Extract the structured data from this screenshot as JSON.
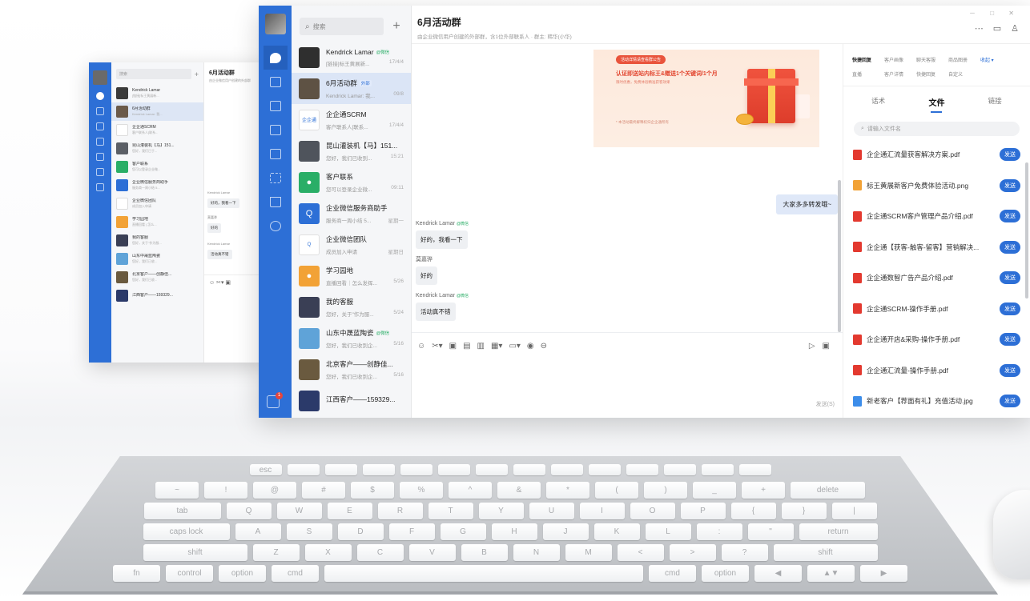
{
  "back_window": {
    "search_placeholder": "搜索",
    "chat_title": "6月活动群",
    "chat_subtitle": "由企业微信用户创建的外部群",
    "contacts": [
      {
        "name": "Kendrick Lamar",
        "preview": "[链接]标王黄展新...",
        "time": "17/4/4",
        "color": "#3a3a3a"
      },
      {
        "name": "6月活动群",
        "preview": "Kendrick Lamar: 我...",
        "time": "",
        "color": "#6b5a4a"
      },
      {
        "name": "企企通SCRM",
        "preview": "客户联系人[联系...",
        "time": "17/4/4",
        "color": "#ffffff"
      },
      {
        "name": "昆山灌装机【马】151...",
        "preview": "您好，我们已于...",
        "time": "15:21",
        "color": "#5b5f66"
      },
      {
        "name": "客户联系",
        "preview": "您可以登录企业微...",
        "time": "09:11",
        "color": "#2aae67"
      },
      {
        "name": "企业微信服务商助手",
        "preview": "服务商一周小结 5...",
        "time": "",
        "color": "#2d6fd6"
      },
      {
        "name": "企业微信团队",
        "preview": "成员加入申请",
        "time": "",
        "color": "#ffffff"
      },
      {
        "name": "学习园地",
        "preview": "直播回看 | 怎么...",
        "time": "5/26",
        "color": "#f2a236"
      },
      {
        "name": "我的客服",
        "preview": "您好，关于\"作为服...",
        "time": "5/24",
        "color": "#3a3f55"
      },
      {
        "name": "山东中晟蓝陶瓷",
        "preview": "您好，我们已收...",
        "time": "5/16",
        "color": "#5fa3d8"
      },
      {
        "name": "北京客户——创静佳...",
        "preview": "您好，我们已收...",
        "time": "5/16",
        "color": "#6a5a3f"
      },
      {
        "name": "江西客户——159329...",
        "preview": "",
        "time": "",
        "color": "#2b3a6a"
      }
    ],
    "msgs": [
      {
        "sender": "Kendrick Lamar",
        "text": "好的，我看一下"
      },
      {
        "sender": "莫嘉骅",
        "text": "好的"
      },
      {
        "sender": "Kendrick Lamar",
        "text": "活动真不错"
      }
    ]
  },
  "sidebar": {
    "icons": [
      "message-icon",
      "mail-icon",
      "workbench-icon",
      "calendar-icon",
      "document-icon",
      "apps-icon",
      "org-icon",
      "settings-icon"
    ],
    "notification_count": "1"
  },
  "conversations": {
    "search_placeholder": "搜索",
    "items": [
      {
        "name": "Kendrick Lamar",
        "tag": "@微信",
        "tag_style": "green",
        "preview": "[链接]标王黄展新...",
        "time": "17/4/4",
        "color": "#2f2f2f",
        "glyph": ""
      },
      {
        "name": "6月活动群",
        "tag": "外部",
        "tag_style": "blue",
        "preview": "Kendrick Lamar: 我...",
        "time": "09/8",
        "color": "#5e5244",
        "glyph": ""
      },
      {
        "name": "企企通SCRM",
        "tag": "",
        "tag_style": "",
        "preview": "客户联系人[联系...",
        "time": "17/4/4",
        "color": "#ffffff",
        "glyph": "企企通"
      },
      {
        "name": "昆山灌装机【马】151...",
        "tag": "",
        "tag_style": "",
        "preview": "您好，我们已收到...",
        "time": "15:21",
        "color": "#4f545c",
        "glyph": ""
      },
      {
        "name": "客户联系",
        "tag": "",
        "tag_style": "",
        "preview": "您可以登录企业微...",
        "time": "09:11",
        "color": "#2aae67",
        "glyph": "●"
      },
      {
        "name": "企业微信服务商助手",
        "tag": "",
        "tag_style": "",
        "preview": "服务商一周小结 5...",
        "time": "星期一",
        "color": "#2d6fd6",
        "glyph": "Q"
      },
      {
        "name": "企业微信团队",
        "tag": "",
        "tag_style": "",
        "preview": "成员加入申请",
        "time": "星期日",
        "color": "#ffffff",
        "glyph": "Q"
      },
      {
        "name": "学习园地",
        "tag": "",
        "tag_style": "",
        "preview": "直播回看｜怎么发挥...",
        "time": "5/26",
        "color": "#f2a236",
        "glyph": "●"
      },
      {
        "name": "我的客服",
        "tag": "",
        "tag_style": "",
        "preview": "您好，关于\"作为服...",
        "time": "5/24",
        "color": "#3a3f55",
        "glyph": ""
      },
      {
        "name": "山东中晟蓝陶瓷",
        "tag": "@微信",
        "tag_style": "green",
        "preview": "您好，我们已收到企...",
        "time": "5/16",
        "color": "#5fa3d8",
        "glyph": ""
      },
      {
        "name": "北京客户——创静佳...",
        "tag": "",
        "tag_style": "",
        "preview": "您好，我们已收到企...",
        "time": "5/16",
        "color": "#6a5a3f",
        "glyph": ""
      },
      {
        "name": "江西客户——159329...",
        "tag": "",
        "tag_style": "",
        "preview": "",
        "time": "",
        "color": "#2b3a6a",
        "glyph": ""
      }
    ]
  },
  "chat": {
    "title": "6月活动群",
    "subtitle": "由企业微信用户创建的外部群，含1位外部联系人 · 群主: 韩华(小华)",
    "window_controls": "－ □ ✕",
    "header_actions": [
      "⋯",
      "▭",
      "♙"
    ],
    "banner": {
      "pill": "活动详情请查看群公告",
      "headline": "认证即送站内标王&赠送1个关键词/1个月",
      "subline": "限时优惠，免费体验精准获客效果",
      "footer": "* 本活动最终解释权归企企通所有"
    },
    "my_message": "大家多多转发哦~",
    "messages": [
      {
        "sender": "Kendrick Lamar",
        "tag": "@微信",
        "text": "好的，我看一下"
      },
      {
        "sender": "莫嘉骅",
        "tag": "",
        "text": "好的"
      },
      {
        "sender": "Kendrick Lamar",
        "tag": "@微信",
        "text": "活动真不错"
      }
    ],
    "toolbar": [
      "☺",
      "✂▾",
      "▣",
      "▤",
      "▥",
      "▦▾",
      "▭▾",
      "◉",
      "⊖"
    ],
    "toolbar_right": [
      "▷",
      "▣"
    ],
    "send_hint": "发送(S)"
  },
  "panel": {
    "row1": [
      "快捷回复",
      "客户画像",
      "聊天客服",
      "商品图册",
      "收起 ▾"
    ],
    "row2": [
      "直播",
      "客户详情",
      "快捷回复",
      "自定义"
    ],
    "tabs": [
      "话术",
      "文件",
      "链接"
    ],
    "active_tab": "文件",
    "search_placeholder": "请输入文件名",
    "send_label": "发送",
    "files": [
      {
        "name": "企企通汇流量获客解决方案.pdf",
        "type": "pdf"
      },
      {
        "name": "标王黄展新客户免费体验活动.png",
        "type": "png"
      },
      {
        "name": "企企通SCRM客户管理产品介绍.pdf",
        "type": "pdf"
      },
      {
        "name": "企企通【获客-触客-留客】营销解决...",
        "type": "pdf"
      },
      {
        "name": "企企通数智广告产品介绍.pdf",
        "type": "pdf"
      },
      {
        "name": "企企通SCRM-操作手册.pdf",
        "type": "pdf"
      },
      {
        "name": "企企通开店&采购-操作手册.pdf",
        "type": "pdf"
      },
      {
        "name": "企企通汇流量-操作手册.pdf",
        "type": "pdf"
      },
      {
        "name": "新老客户【荐面有礼】充值活动.jpg",
        "type": "jpg"
      }
    ]
  },
  "keyboard": {
    "rows": [
      [
        "esc",
        "",
        "",
        "",
        "",
        "",
        "",
        "",
        "",
        "",
        "",
        "",
        "",
        ""
      ],
      [
        "~",
        "!",
        "@",
        "#",
        "$",
        "%",
        "^",
        "&",
        "*",
        "(",
        ")",
        "_",
        "+",
        "delete"
      ],
      [
        "tab",
        "Q",
        "W",
        "E",
        "R",
        "T",
        "Y",
        "U",
        "I",
        "O",
        "P",
        "{",
        "}",
        "|"
      ],
      [
        "caps lock",
        "A",
        "S",
        "D",
        "F",
        "G",
        "H",
        "J",
        "K",
        "L",
        ":",
        "\"",
        "return"
      ],
      [
        "shift",
        "Z",
        "X",
        "C",
        "V",
        "B",
        "N",
        "M",
        "<",
        ">",
        "?",
        "shift"
      ],
      [
        "fn",
        "control",
        "option",
        "cmd",
        "",
        "cmd",
        "option",
        "◀",
        "▲▼",
        "▶"
      ]
    ]
  }
}
